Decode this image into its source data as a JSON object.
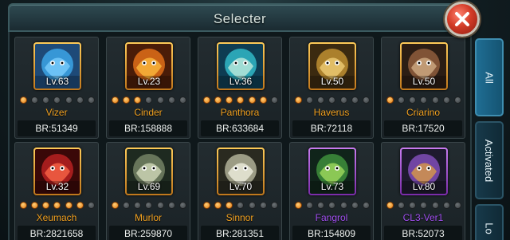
{
  "header": {
    "title": "Selecter"
  },
  "tabs": [
    {
      "label": "All",
      "active": true
    },
    {
      "label": "Activated",
      "active": false
    },
    {
      "label": "Lo",
      "active": false
    }
  ],
  "colors": {
    "name_orange": "#f0a020",
    "name_purple": "#a14ff0",
    "frame_gold": "#e4a030",
    "frame_purple": "#a14ff0",
    "star_on": "#ff9a1a",
    "tab_active": "#1f6d93"
  },
  "heroes": [
    {
      "name": "Vizer",
      "level": "Lv.63",
      "br": "BR:51349",
      "stars_on": 1,
      "rarity": "gold",
      "icon": "blue-dragon-portrait"
    },
    {
      "name": "Cinder",
      "level": "Lv.23",
      "br": "BR:158888",
      "stars_on": 3,
      "rarity": "gold",
      "icon": "fire-golem-portrait"
    },
    {
      "name": "Panthora",
      "level": "Lv.36",
      "br": "BR:633684",
      "stars_on": 6,
      "rarity": "gold",
      "icon": "sea-serpent-portrait"
    },
    {
      "name": "Haverus",
      "level": "Lv.50",
      "br": "BR:72118",
      "stars_on": 1,
      "rarity": "gold",
      "icon": "golden-armor-portrait"
    },
    {
      "name": "Criarino",
      "level": "Lv.50",
      "br": "BR:17520",
      "stars_on": 1,
      "rarity": "gold",
      "icon": "armored-beast-portrait"
    },
    {
      "name": "Xeumach",
      "level": "Lv.32",
      "br": "BR:2821658",
      "stars_on": 6,
      "rarity": "gold",
      "icon": "red-demon-portrait"
    },
    {
      "name": "Murlor",
      "level": "Lv.69",
      "br": "BR:259870",
      "stars_on": 1,
      "rarity": "gold",
      "icon": "stone-beast-portrait"
    },
    {
      "name": "Sinnor",
      "level": "Lv.70",
      "br": "BR:281351",
      "stars_on": 3,
      "rarity": "gold",
      "icon": "bone-dragon-portrait"
    },
    {
      "name": "Fangrol",
      "level": "Lv.73",
      "br": "BR:154809",
      "stars_on": 1,
      "rarity": "purple",
      "icon": "green-wolf-portrait"
    },
    {
      "name": "CL3-Ver1",
      "level": "Lv.80",
      "br": "BR:52073",
      "stars_on": 1,
      "rarity": "purple",
      "icon": "mech-robot-portrait"
    }
  ]
}
